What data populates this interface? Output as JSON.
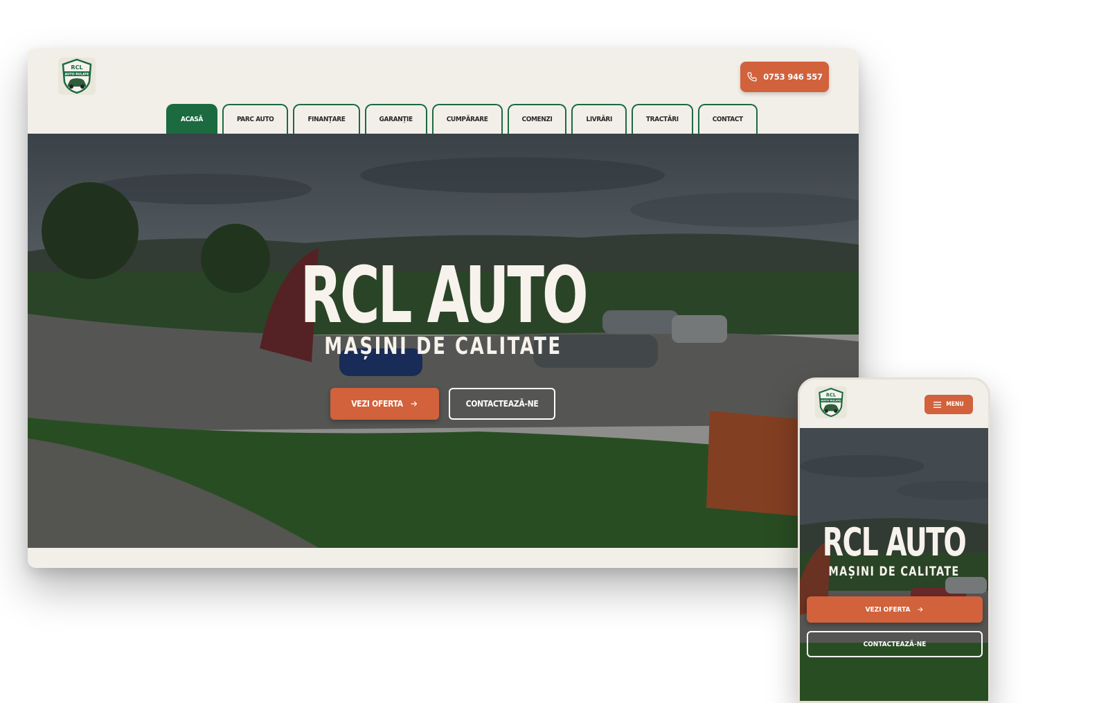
{
  "brand": {
    "logo_top": "RCL",
    "logo_ribbon": "AUTO RULATE",
    "colors": {
      "green": "#1c6a3f",
      "accent": "#d1623c",
      "cream": "#f2efe9"
    }
  },
  "header": {
    "phone": "0753 946 557",
    "phone_icon": "phone-icon"
  },
  "nav": {
    "items": [
      {
        "label": "ACASĂ",
        "active": true
      },
      {
        "label": "PARC AUTO"
      },
      {
        "label": "FINANȚARE"
      },
      {
        "label": "GARANȚIE"
      },
      {
        "label": "CUMPĂRARE"
      },
      {
        "label": "COMENZI"
      },
      {
        "label": "LIVRĂRI"
      },
      {
        "label": "TRACTĂRI"
      },
      {
        "label": "CONTACT"
      }
    ]
  },
  "hero": {
    "title": "RCL AUTO",
    "subtitle": "MAȘINI DE CALITATE",
    "cta_primary": "VEZI OFERTA",
    "cta_secondary": "CONTACTEAZĂ-NE",
    "cta_icon": "arrow-right-icon"
  },
  "mobile": {
    "menu_label": "MENU",
    "menu_icon": "hamburger-icon"
  }
}
